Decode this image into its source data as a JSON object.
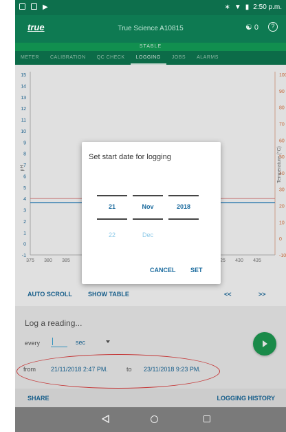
{
  "status_bar": {
    "time": "2:50 p.m."
  },
  "app_bar": {
    "logo": "true",
    "title": "True Science A10815",
    "basket_count": "0",
    "help_icon": "?"
  },
  "status_strip": {
    "label": "STABLE"
  },
  "tabs": [
    {
      "label": "METER"
    },
    {
      "label": "CALIBRATION"
    },
    {
      "label": "QC CHECK"
    },
    {
      "label": "LOGGING"
    },
    {
      "label": "JOBS"
    },
    {
      "label": "ALARMS"
    }
  ],
  "active_tab": "LOGGING",
  "graph": {
    "y_left_label": "pH",
    "y_right_label": "Temperature (°C)",
    "y_left_ticks": [
      "15",
      "14",
      "13",
      "12",
      "11",
      "10",
      "9",
      "8",
      "7",
      "6",
      "5",
      "4",
      "3",
      "2",
      "1",
      "0",
      "-1"
    ],
    "y_right_ticks": [
      "100",
      "90",
      "80",
      "70",
      "60",
      "50",
      "40",
      "30",
      "20",
      "10",
      "0",
      "-10"
    ],
    "x_ticks": [
      "375",
      "380",
      "385",
      "425",
      "430",
      "435"
    ],
    "line_color": "#3b8fc9",
    "right_axis_color": "#e0703c"
  },
  "controls": {
    "auto_scroll": "AUTO SCROLL",
    "show_table": "SHOW TABLE",
    "prev": "<<",
    "next": ">>"
  },
  "log_panel": {
    "title": "Log a reading...",
    "every_label": "every",
    "unit": "sec",
    "from_label": "from",
    "from_value": "21/11/2018 2:47 PM.",
    "to_label": "to",
    "to_value": "23/11/2018 9:23 PM."
  },
  "bottom_actions": {
    "share": "SHARE",
    "logging_history": "LOGGING HISTORY"
  },
  "dialog": {
    "title": "Set start date for logging",
    "day_selected": "21",
    "month_selected": "Nov",
    "year_selected": "2018",
    "day_next": "22",
    "month_next": "Dec",
    "cancel": "CANCEL",
    "set": "SET"
  }
}
